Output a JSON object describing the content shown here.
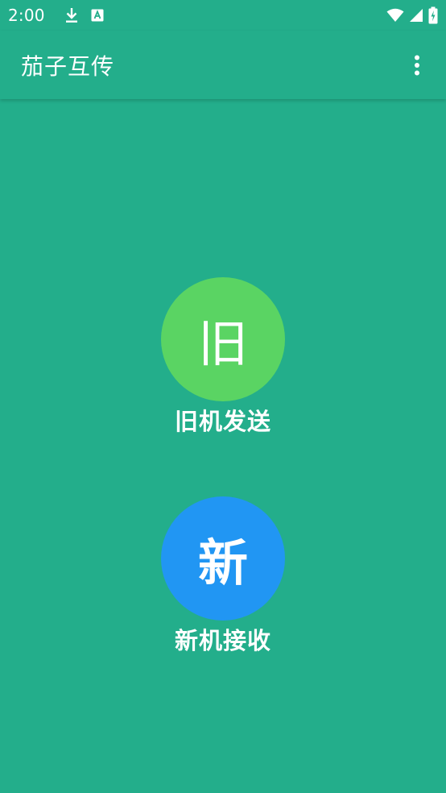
{
  "status_bar": {
    "time": "2:00",
    "icons_left": [
      "download-icon",
      "keyboard-a-icon"
    ],
    "icons_right": [
      "wifi-icon",
      "signal-icon",
      "battery-charging-icon"
    ]
  },
  "app_bar": {
    "title": "茄子互传",
    "menu_icon": "more-vert-icon"
  },
  "actions": {
    "old": {
      "circle_text": "旧",
      "label": "旧机发送",
      "color": "#5ad463"
    },
    "new": {
      "circle_text": "新",
      "label": "新机接收",
      "color": "#2196f3"
    }
  },
  "colors": {
    "background": "#23ae8b",
    "text": "#ffffff"
  }
}
